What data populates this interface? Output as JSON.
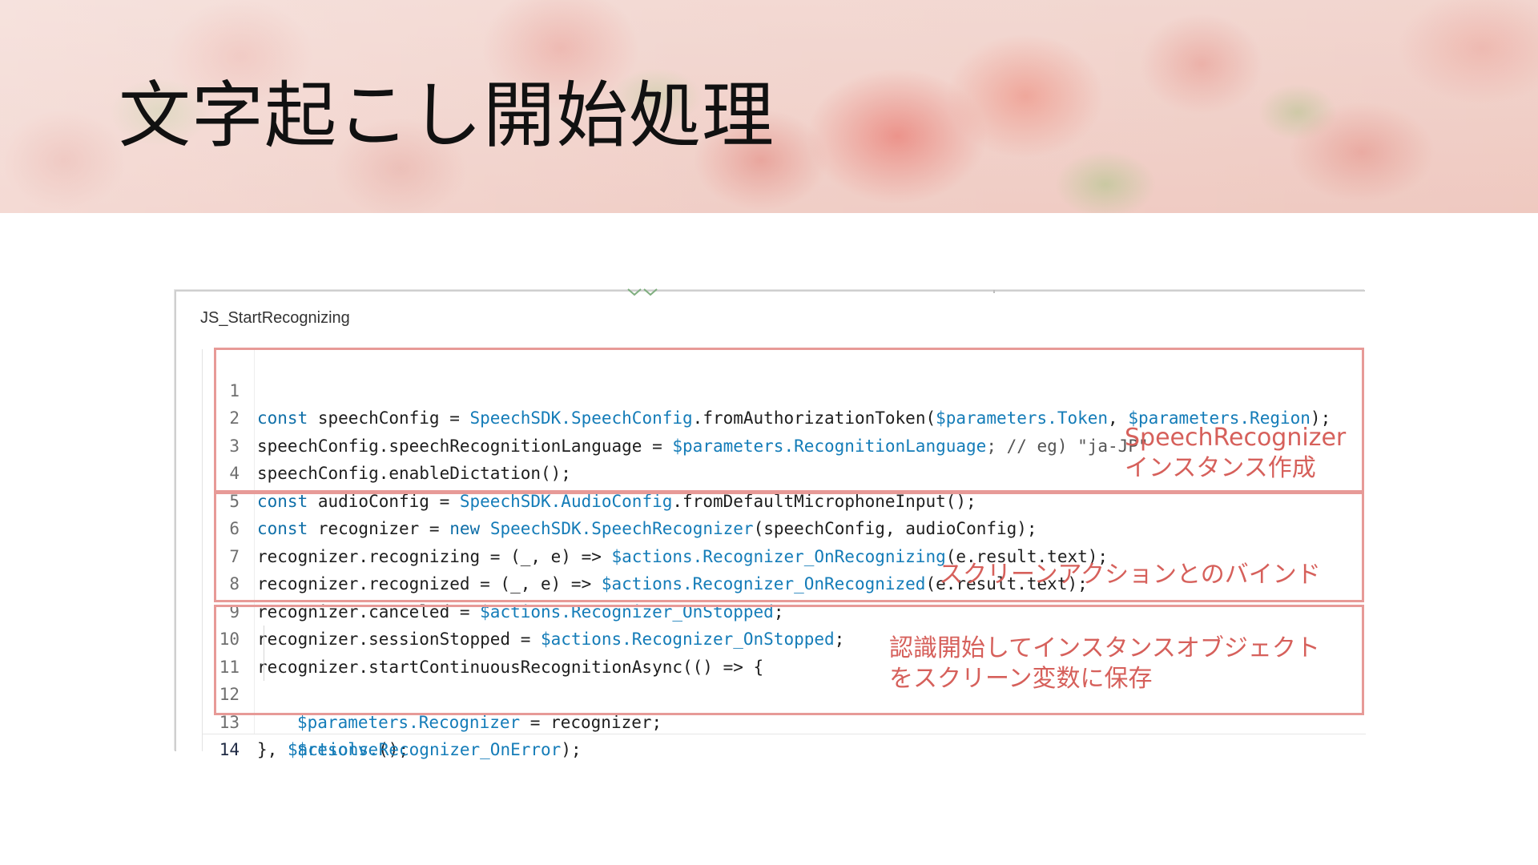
{
  "slide": {
    "title": "文字起こし開始処理"
  },
  "panel": {
    "title": "JS_StartRecognizing"
  },
  "colors": {
    "keyword": "#0f6fa8",
    "reference": "#147cb8",
    "annotation": "#d6605b",
    "annotation_border": "#e79a97"
  },
  "code_lines": [
    {
      "n": "1"
    },
    {
      "n": "2"
    },
    {
      "n": "3"
    },
    {
      "n": "4"
    },
    {
      "n": "5"
    },
    {
      "n": "6"
    },
    {
      "n": "7"
    },
    {
      "n": "8"
    },
    {
      "n": "9"
    },
    {
      "n": "10"
    },
    {
      "n": "11"
    },
    {
      "n": "12"
    },
    {
      "n": "13"
    },
    {
      "n": "14"
    }
  ],
  "tokens": {
    "l1": [
      "const",
      " speechConfig = ",
      "SpeechSDK.SpeechConfig",
      ".fromAuthorizationToken(",
      "$parameters.Token",
      ", ",
      "$parameters.Region",
      ");"
    ],
    "l2": [
      "speechConfig.speechRecognitionLanguage = ",
      "$parameters.RecognitionLanguage",
      "; // eg) \"ja-JP\""
    ],
    "l3": [
      "speechConfig.enableDictation();"
    ],
    "l4": [
      "const",
      " audioConfig = ",
      "SpeechSDK.AudioConfig",
      ".fromDefaultMicrophoneInput();"
    ],
    "l5": [
      "const",
      " recognizer = ",
      "new",
      " ",
      "SpeechSDK.SpeechRecognizer",
      "(speechConfig, audioConfig);"
    ],
    "l6": [
      "recognizer.recognizing = (_, e) => ",
      "$actions.Recognizer_OnRecognizing",
      "(e.result.text);"
    ],
    "l7": [
      "recognizer.recognized = (_, e) => ",
      "$actions.Recognizer_OnRecognized",
      "(e.result.text);"
    ],
    "l8": [
      "recognizer.canceled = ",
      "$actions.Recognizer_OnStopped",
      ";"
    ],
    "l9": [
      "recognizer.sessionStopped = ",
      "$actions.Recognizer_OnStopped",
      ";"
    ],
    "l10": [
      "recognizer.startContinuousRecognitionAsync(() => {"
    ],
    "l11": [
      "$parameters.Recognizer",
      " = recognizer;"
    ],
    "l12": [
      "$resolve",
      "();"
    ],
    "l13": [
      "}, ",
      "$actions.Recognizer_OnError",
      ");"
    ]
  },
  "annotations": {
    "a1": "SpeechRecognizer\nインスタンス作成",
    "a2": "スクリーンアクションとのバインド",
    "a3": "認識開始してインスタンスオブジェクト\nをスクリーン変数に保存"
  }
}
